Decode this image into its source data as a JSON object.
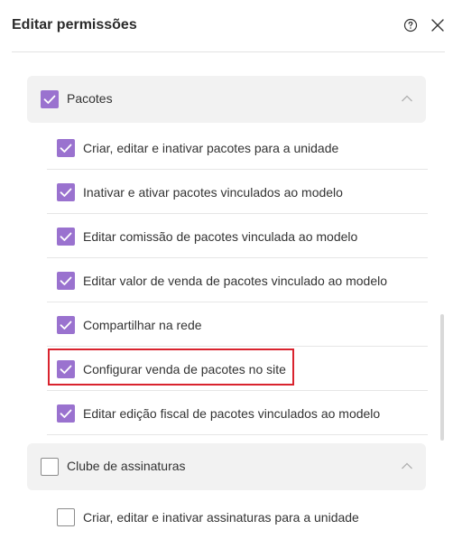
{
  "header": {
    "title": "Editar permissões",
    "help_icon": "question-circle-icon",
    "close_icon": "close-icon"
  },
  "colors": {
    "checkbox_checked": "#9a72cf",
    "section_header_bg": "#f2f2f2",
    "highlight_border": "#d9232e"
  },
  "sections": [
    {
      "label": "Pacotes",
      "checked": true,
      "expanded": true,
      "items": [
        {
          "label": "Criar, editar e inativar pacotes para a unidade",
          "checked": true
        },
        {
          "label": "Inativar e ativar pacotes vinculados ao modelo",
          "checked": true
        },
        {
          "label": "Editar comissão de pacotes vinculada ao modelo",
          "checked": true
        },
        {
          "label": "Editar valor de venda de pacotes vinculado ao modelo",
          "checked": true
        },
        {
          "label": "Compartilhar na rede",
          "checked": true
        },
        {
          "label": "Configurar venda de pacotes no site",
          "checked": true,
          "highlighted": true
        },
        {
          "label": "Editar edição fiscal de pacotes vinculados ao modelo",
          "checked": true
        }
      ]
    },
    {
      "label": "Clube de assinaturas",
      "checked": false,
      "expanded": true,
      "items": [
        {
          "label": "Criar, editar e inativar assinaturas para a unidade",
          "checked": false
        }
      ]
    }
  ]
}
